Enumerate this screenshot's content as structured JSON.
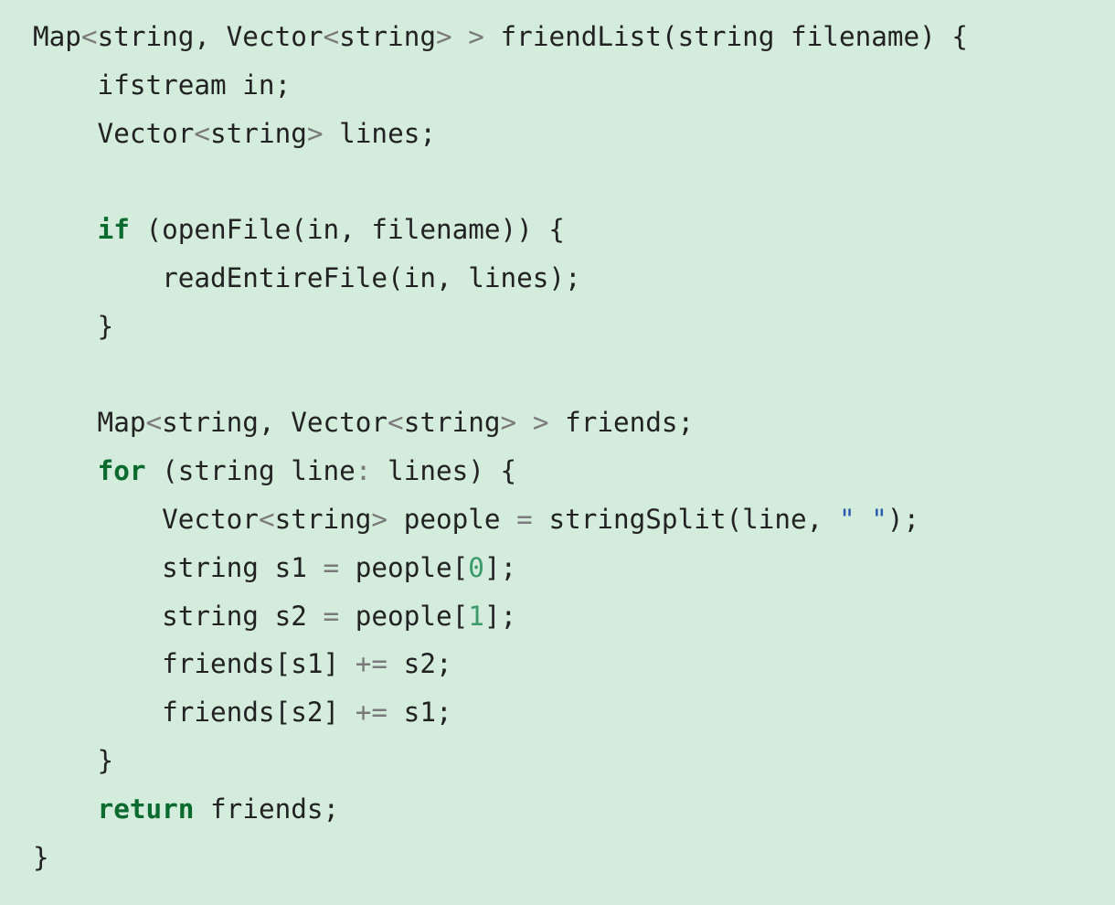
{
  "code": {
    "language": "C++",
    "colors": {
      "background": "#d4ecdb",
      "text": "#222222",
      "keyword": "#0b6b2e",
      "operator": "#7a7a7a",
      "number": "#3a9a6a",
      "string": "#2a5bb0"
    },
    "lines": [
      [
        {
          "t": "id",
          "v": "Map"
        },
        {
          "t": "op",
          "v": "<"
        },
        {
          "t": "id",
          "v": "string, Vector"
        },
        {
          "t": "op",
          "v": "<"
        },
        {
          "t": "id",
          "v": "string"
        },
        {
          "t": "op",
          "v": ">"
        },
        {
          "t": "id",
          "v": " "
        },
        {
          "t": "op",
          "v": ">"
        },
        {
          "t": "id",
          "v": " friendList(string filename) {"
        }
      ],
      [
        {
          "t": "id",
          "v": "    ifstream in;"
        }
      ],
      [
        {
          "t": "id",
          "v": "    Vector"
        },
        {
          "t": "op",
          "v": "<"
        },
        {
          "t": "id",
          "v": "string"
        },
        {
          "t": "op",
          "v": ">"
        },
        {
          "t": "id",
          "v": " lines;"
        }
      ],
      [],
      [
        {
          "t": "id",
          "v": "    "
        },
        {
          "t": "kw",
          "v": "if"
        },
        {
          "t": "id",
          "v": " (openFile(in, filename)) {"
        }
      ],
      [
        {
          "t": "id",
          "v": "        readEntireFile(in, lines);"
        }
      ],
      [
        {
          "t": "id",
          "v": "    }"
        }
      ],
      [],
      [
        {
          "t": "id",
          "v": "    Map"
        },
        {
          "t": "op",
          "v": "<"
        },
        {
          "t": "id",
          "v": "string, Vector"
        },
        {
          "t": "op",
          "v": "<"
        },
        {
          "t": "id",
          "v": "string"
        },
        {
          "t": "op",
          "v": ">"
        },
        {
          "t": "id",
          "v": " "
        },
        {
          "t": "op",
          "v": ">"
        },
        {
          "t": "id",
          "v": " friends;"
        }
      ],
      [
        {
          "t": "id",
          "v": "    "
        },
        {
          "t": "kw",
          "v": "for"
        },
        {
          "t": "id",
          "v": " (string line"
        },
        {
          "t": "op",
          "v": ":"
        },
        {
          "t": "id",
          "v": " lines) {"
        }
      ],
      [
        {
          "t": "id",
          "v": "        Vector"
        },
        {
          "t": "op",
          "v": "<"
        },
        {
          "t": "id",
          "v": "string"
        },
        {
          "t": "op",
          "v": ">"
        },
        {
          "t": "id",
          "v": " people "
        },
        {
          "t": "op",
          "v": "="
        },
        {
          "t": "id",
          "v": " stringSplit(line, "
        },
        {
          "t": "str",
          "v": "\" \""
        },
        {
          "t": "id",
          "v": ");"
        }
      ],
      [
        {
          "t": "id",
          "v": "        string s1 "
        },
        {
          "t": "op",
          "v": "="
        },
        {
          "t": "id",
          "v": " people["
        },
        {
          "t": "num",
          "v": "0"
        },
        {
          "t": "id",
          "v": "];"
        }
      ],
      [
        {
          "t": "id",
          "v": "        string s2 "
        },
        {
          "t": "op",
          "v": "="
        },
        {
          "t": "id",
          "v": " people["
        },
        {
          "t": "num",
          "v": "1"
        },
        {
          "t": "id",
          "v": "];"
        }
      ],
      [
        {
          "t": "id",
          "v": "        friends[s1] "
        },
        {
          "t": "op",
          "v": "+="
        },
        {
          "t": "id",
          "v": " s2;"
        }
      ],
      [
        {
          "t": "id",
          "v": "        friends[s2] "
        },
        {
          "t": "op",
          "v": "+="
        },
        {
          "t": "id",
          "v": " s1;"
        }
      ],
      [
        {
          "t": "id",
          "v": "    }"
        }
      ],
      [
        {
          "t": "id",
          "v": "    "
        },
        {
          "t": "kw",
          "v": "return"
        },
        {
          "t": "id",
          "v": " friends;"
        }
      ],
      [
        {
          "t": "id",
          "v": "}"
        }
      ]
    ]
  }
}
